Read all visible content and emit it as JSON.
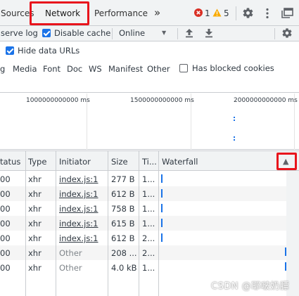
{
  "tabs": {
    "sources": "Sources",
    "network": "Network",
    "performance": "Performance",
    "more": "»"
  },
  "status": {
    "errors": "1",
    "warnings": "5",
    "error_color": "#d93025",
    "warning_color": "#f9ab00"
  },
  "toolbar": {
    "preserve_log": "serve log",
    "disable_cache": "Disable cache",
    "throttle": "Online",
    "throttle_caret": "▼",
    "upload_icon": "upload-icon",
    "download_icon": "download-icon"
  },
  "filter": {
    "hide_data_urls": "Hide data URLs",
    "types": [
      "g",
      "Media",
      "Font",
      "Doc",
      "WS",
      "Manifest",
      "Other"
    ],
    "blocked_cookies": "Has blocked cookies"
  },
  "overview": {
    "ticks": [
      "1000000000000 ms",
      "1500000000000 ms",
      "2000000000000 ms"
    ]
  },
  "table": {
    "headers": [
      "tatus",
      "Type",
      "Initiator",
      "Size",
      "Ti...",
      "Waterfall"
    ],
    "sort_indicator": "▲",
    "rows": [
      {
        "status": "00",
        "type": "xhr",
        "initiator": "index.js:1",
        "size": "277 B",
        "time": "1...",
        "link": true
      },
      {
        "status": "00",
        "type": "xhr",
        "initiator": "index.js:1",
        "size": "612 B",
        "time": "1...",
        "link": true
      },
      {
        "status": "00",
        "type": "xhr",
        "initiator": "index.js:1",
        "size": "758 B",
        "time": "1...",
        "link": true
      },
      {
        "status": "00",
        "type": "xhr",
        "initiator": "index.js:1",
        "size": "615 B",
        "time": "1...",
        "link": true
      },
      {
        "status": "00",
        "type": "xhr",
        "initiator": "index.js:1",
        "size": "612 B",
        "time": "2...",
        "link": true
      },
      {
        "status": "00",
        "type": "xhr",
        "initiator": "Other",
        "size": "208 ...",
        "time": "2...",
        "link": false
      },
      {
        "status": "00",
        "type": "xhr",
        "initiator": "Other",
        "size": "4.0 kB",
        "time": "1...",
        "link": false
      }
    ]
  },
  "watermark": "CSDN @耶啵奶膘",
  "colors": {
    "accent": "#1a73e8",
    "highlight": "#e8141c"
  }
}
